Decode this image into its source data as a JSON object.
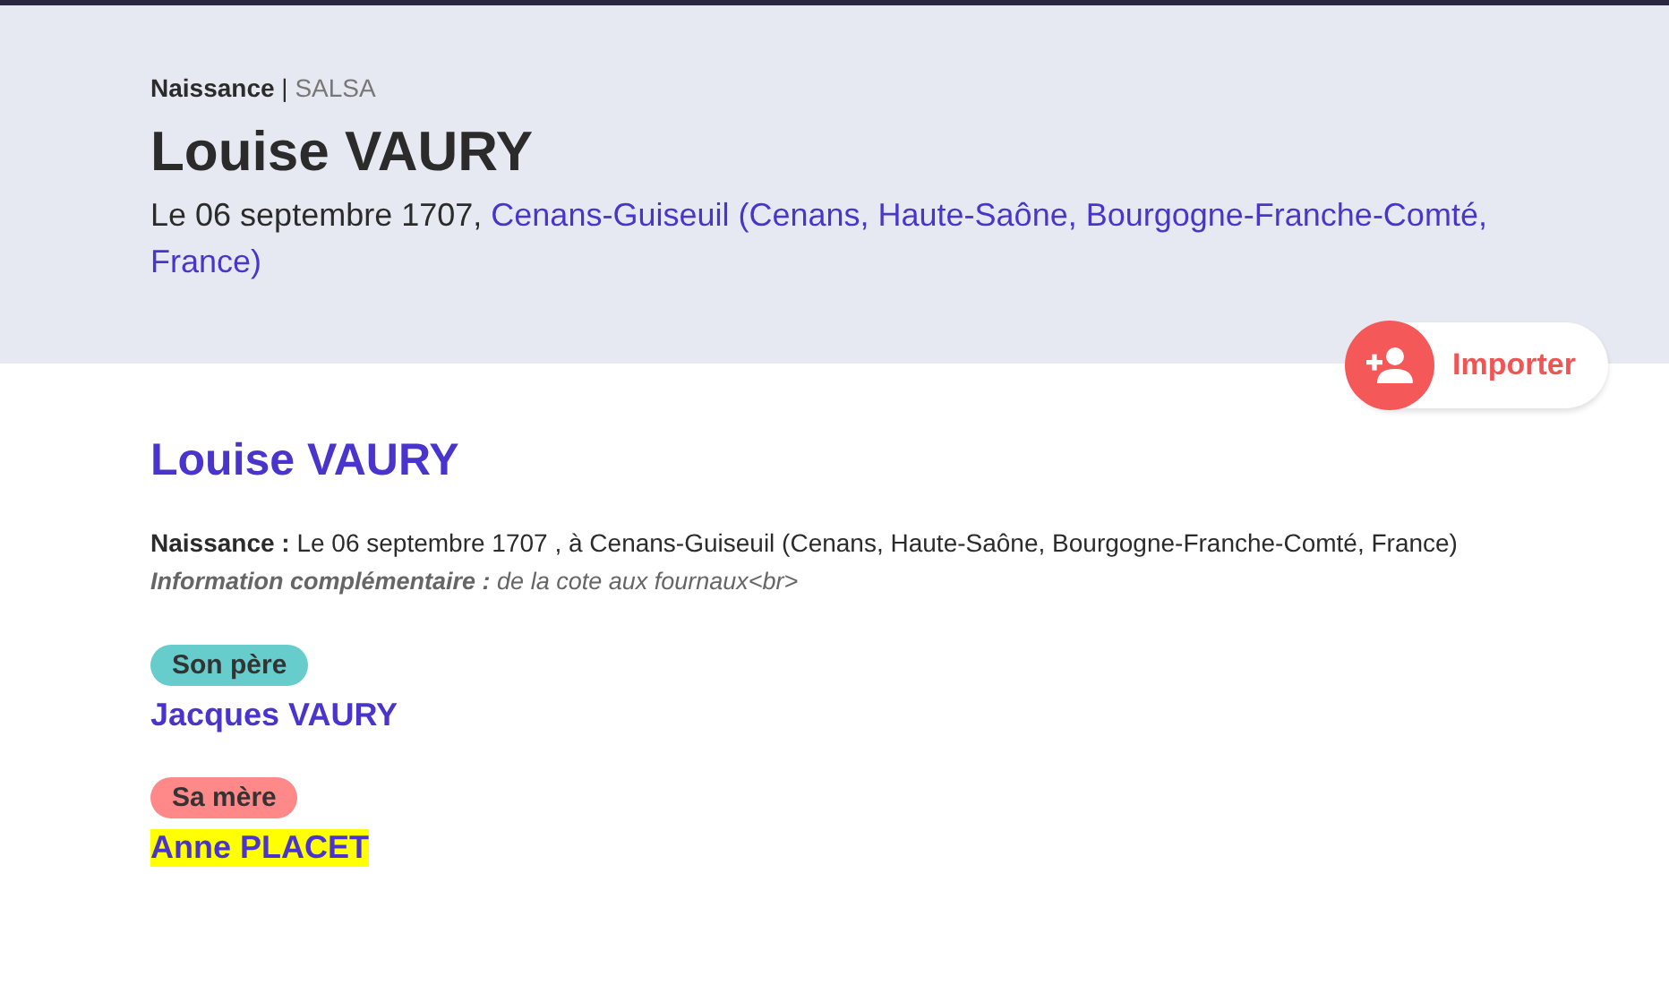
{
  "header": {
    "event": "Naissance",
    "separator": "|",
    "source": "SALSA",
    "name": "Louise VAURY",
    "date": "Le 06 septembre 1707,",
    "place": "Cenans-Guiseuil (Cenans, Haute-Saône, Bourgogne-Franche-Comté, France)"
  },
  "import_button": {
    "label": "Importer"
  },
  "person": {
    "name": "Louise VAURY",
    "facts": [
      {
        "label": "Naissance :",
        "text": "Le 06 septembre 1707 , à Cenans-Guiseuil (Cenans, Haute-Saône, Bourgogne-Franche-Comté, France)",
        "kind": "plain"
      },
      {
        "label": "Information complémentaire :",
        "text": "de la cote aux fournaux<br>",
        "kind": "note"
      }
    ]
  },
  "parents": [
    {
      "role": "Son père",
      "color": "#66cccc",
      "name": "Jacques VAURY",
      "highlighted": false
    },
    {
      "role": "Sa mère",
      "color": "#ff8888",
      "name": "Anne PLACET",
      "highlighted": true
    }
  ]
}
